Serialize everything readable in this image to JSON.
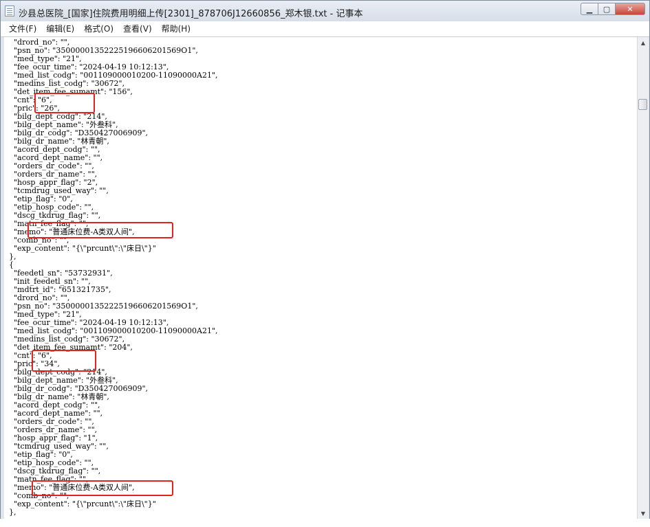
{
  "window": {
    "title": "沙县总医院_[国家]住院费用明细上传[2301]_878706J12660856_郑木银.txt - 记事本",
    "buttons": {
      "minimize": "▁",
      "maximize": "▢",
      "close": "✕"
    }
  },
  "menu": [
    "文件(F)",
    "编辑(E)",
    "格式(O)",
    "查看(V)",
    "帮助(H)"
  ],
  "lines": [
    "    \"drord_no\": \"\",",
    "    \"psn_no\": \"35000001352225196606201569O1\",",
    "    \"med_type\": \"21\",",
    "    \"fee_ocur_time\": \"2024-04-19 10:12:13\",",
    "    \"med_list_codg\": \"001109000010200-11090000A21\",",
    "    \"medins_list_codg\": \"30672\",",
    "    \"det_item_fee_sumamt\": \"156\",",
    "    \"cnt\": \"6\",",
    "    \"pric\": \"26\",",
    "    \"bilg_dept_codg\": \"214\",",
    "    \"bilg_dept_name\": \"外叁科\",",
    "    \"bilg_dr_codg\": \"D350427006909\",",
    "    \"bilg_dr_name\": \"林青朝\",",
    "    \"acord_dept_codg\": \"\",",
    "    \"acord_dept_name\": \"\",",
    "    \"orders_dr_code\": \"\",",
    "    \"orders_dr_name\": \"\",",
    "    \"hosp_appr_flag\": \"2\",",
    "    \"tcmdrug_used_way\": \"\",",
    "    \"etip_flag\": \"0\",",
    "    \"etip_hosp_code\": \"\",",
    "    \"dscg_tkdrug_flag\": \"\",",
    "    \"matn_fee_flag\": \"\",",
    "    \"memo\": \"普通床位费-A类双人间\",",
    "    \"comb_no\": \"\",",
    "    \"exp_content\": \"{\\\"prcunt\\\":\\\"床日\\\"}\"",
    "  },",
    "  {",
    "    \"feedetl_sn\": \"53732931\",",
    "    \"init_feedetl_sn\": \"\",",
    "    \"mdtrt_id\": \"651321735\",",
    "    \"drord_no\": \"\",",
    "    \"psn_no\": \"35000001352225196606201569O1\",",
    "    \"med_type\": \"21\",",
    "    \"fee_ocur_time\": \"2024-04-19 10:12:13\",",
    "    \"med_list_codg\": \"001109000010200-11090000A21\",",
    "    \"medins_list_codg\": \"30672\",",
    "    \"det_item_fee_sumamt\": \"204\",",
    "    \"cnt\": \"6\",",
    "    \"pric\": \"34\",",
    "    \"bilg_dept_codg\": \"214\",",
    "    \"bilg_dept_name\": \"外叁科\",",
    "    \"bilg_dr_codg\": \"D350427006909\",",
    "    \"bilg_dr_name\": \"林青朝\",",
    "    \"acord_dept_codg\": \"\",",
    "    \"acord_dept_name\": \"\",",
    "    \"orders_dr_code\": \"\",",
    "    \"orders_dr_name\": \"\",",
    "    \"hosp_appr_flag\": \"1\",",
    "    \"tcmdrug_used_way\": \"\",",
    "    \"etip_flag\": \"0\",",
    "    \"etip_hosp_code\": \"\",",
    "    \"dscg_tkdrug_flag\": \"\",",
    "    \"matn_fee_flag\": \"\",",
    "    \"memo\": \"普通床位费-A类双人间\",",
    "    \"comb_no\": \"\",",
    "    \"exp_content\": \"{\\\"prcunt\\\":\\\"床日\\\"}\"",
    "  },"
  ],
  "colors": {
    "highlight": "#e3231b"
  }
}
